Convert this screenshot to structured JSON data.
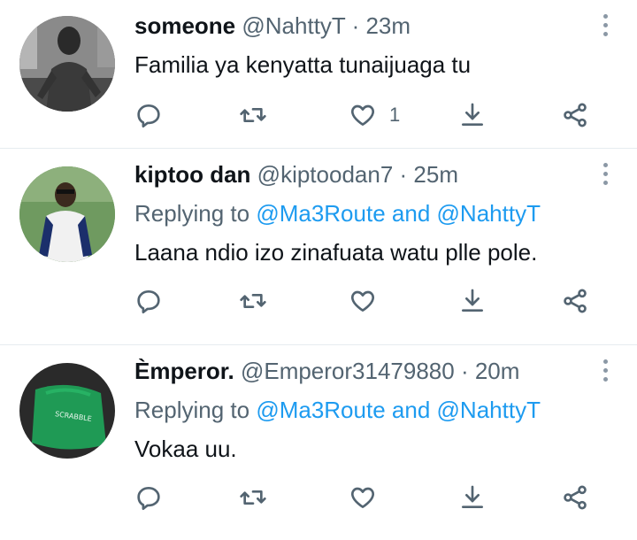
{
  "tweets": [
    {
      "name": "someone",
      "handle": "@NahttyT",
      "time": "· 23m",
      "replying_prefix": "",
      "replying_to": [],
      "text": "Familia ya kenyatta tunaijuaga tu",
      "like_count": "1"
    },
    {
      "name": "kiptoo dan",
      "handle": "@kiptoodan7",
      "time": "· 25m",
      "replying_prefix": "Replying to",
      "replying_to": [
        "@Ma3Route",
        "@NahttyT"
      ],
      "replying_and": "and",
      "text": "Laana ndio izo zinafuata watu plle pole.",
      "like_count": ""
    },
    {
      "name": "Èmperor.",
      "handle": "@Emperor31479880",
      "time": "· 20m",
      "replying_prefix": "Replying to",
      "replying_to": [
        "@Ma3Route",
        "@NahttyT"
      ],
      "replying_and": "and",
      "text": "Vokaa uu.",
      "like_count": "",
      "avatar_text": "SCRABBLE"
    }
  ],
  "icons": [
    "reply-icon",
    "retweet-icon",
    "like-icon",
    "download-icon",
    "share-icon",
    "more-icon"
  ],
  "colors": {
    "link": "#1d9bf0",
    "secondary": "#536471",
    "primary": "#0f1419",
    "divider": "#e6ecf0"
  }
}
